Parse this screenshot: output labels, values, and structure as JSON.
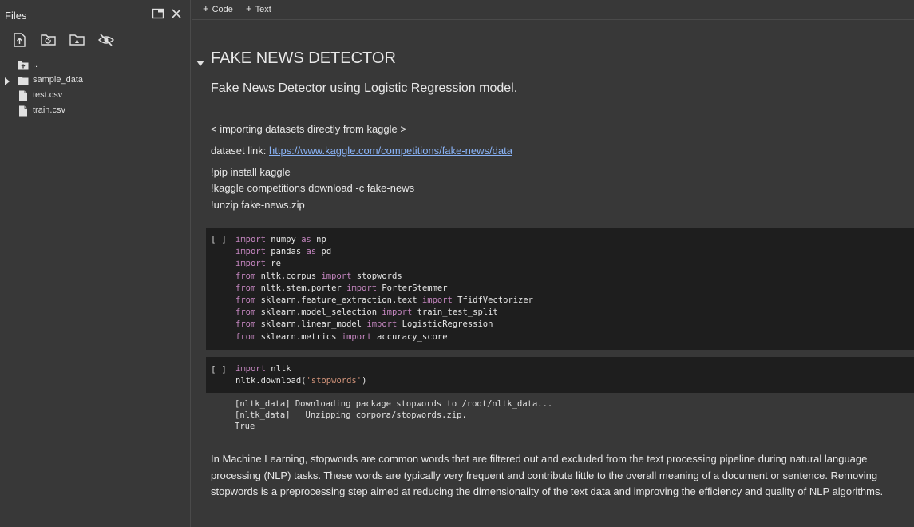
{
  "sidebar": {
    "title": "Files",
    "tree": [
      {
        "label": ".."
      },
      {
        "label": "sample_data"
      },
      {
        "label": "test.csv"
      },
      {
        "label": "train.csv"
      }
    ]
  },
  "toolbar": {
    "code_label": "Code",
    "text_label": "Text"
  },
  "notebook": {
    "heading": "FAKE NEWS DETECTOR",
    "subtitle": "Fake News Detector using Logistic Regression model.",
    "import_note": "< importing datasets directly from kaggle >",
    "dataset_prefix": "dataset link: ",
    "dataset_url": "https://www.kaggle.com/competitions/fake-news/data",
    "shell_lines": [
      "!pip install kaggle",
      "!kaggle competitions download -c fake-news",
      "!unzip fake-news.zip"
    ],
    "run_bracket": "[ ]",
    "cell1": [
      {
        "kw": "import",
        "rest": " numpy ",
        "kw2": "as",
        "rest2": " np"
      },
      {
        "kw": "import",
        "rest": " pandas ",
        "kw2": "as",
        "rest2": " pd"
      },
      {
        "kw": "import",
        "rest": " re",
        "kw2": "",
        "rest2": ""
      },
      {
        "kw": "from",
        "rest": " nltk.corpus ",
        "kw2": "import",
        "rest2": " stopwords"
      },
      {
        "kw": "from",
        "rest": " nltk.stem.porter ",
        "kw2": "import",
        "rest2": " PorterStemmer"
      },
      {
        "kw": "from",
        "rest": " sklearn.feature_extraction.text ",
        "kw2": "import",
        "rest2": " TfidfVectorizer"
      },
      {
        "kw": "from",
        "rest": " sklearn.model_selection ",
        "kw2": "import",
        "rest2": " train_test_split"
      },
      {
        "kw": "from",
        "rest": " sklearn.linear_model ",
        "kw2": "import",
        "rest2": " LogisticRegression"
      },
      {
        "kw": "from",
        "rest": " sklearn.metrics ",
        "kw2": "import",
        "rest2": " accuracy_score"
      }
    ],
    "cell2_line1_kw": "import",
    "cell2_line1_rest": " nltk",
    "cell2_line2_pre": "nltk.download(",
    "cell2_line2_str": "'stopwords'",
    "cell2_line2_post": ")",
    "cell2_output": [
      "[nltk_data] Downloading package stopwords to /root/nltk_data...",
      "[nltk_data]   Unzipping corpora/stopwords.zip.",
      "True"
    ],
    "paragraph": "In Machine Learning, stopwords are common words that are filtered out and excluded from the text processing pipeline during natural language processing (NLP) tasks. These words are typically very frequent and contribute little to the overall meaning of a document or sentence. Removing stopwords is a preprocessing step aimed at reducing the dimensionality of the text data and improving the efficiency and quality of NLP algorithms."
  }
}
